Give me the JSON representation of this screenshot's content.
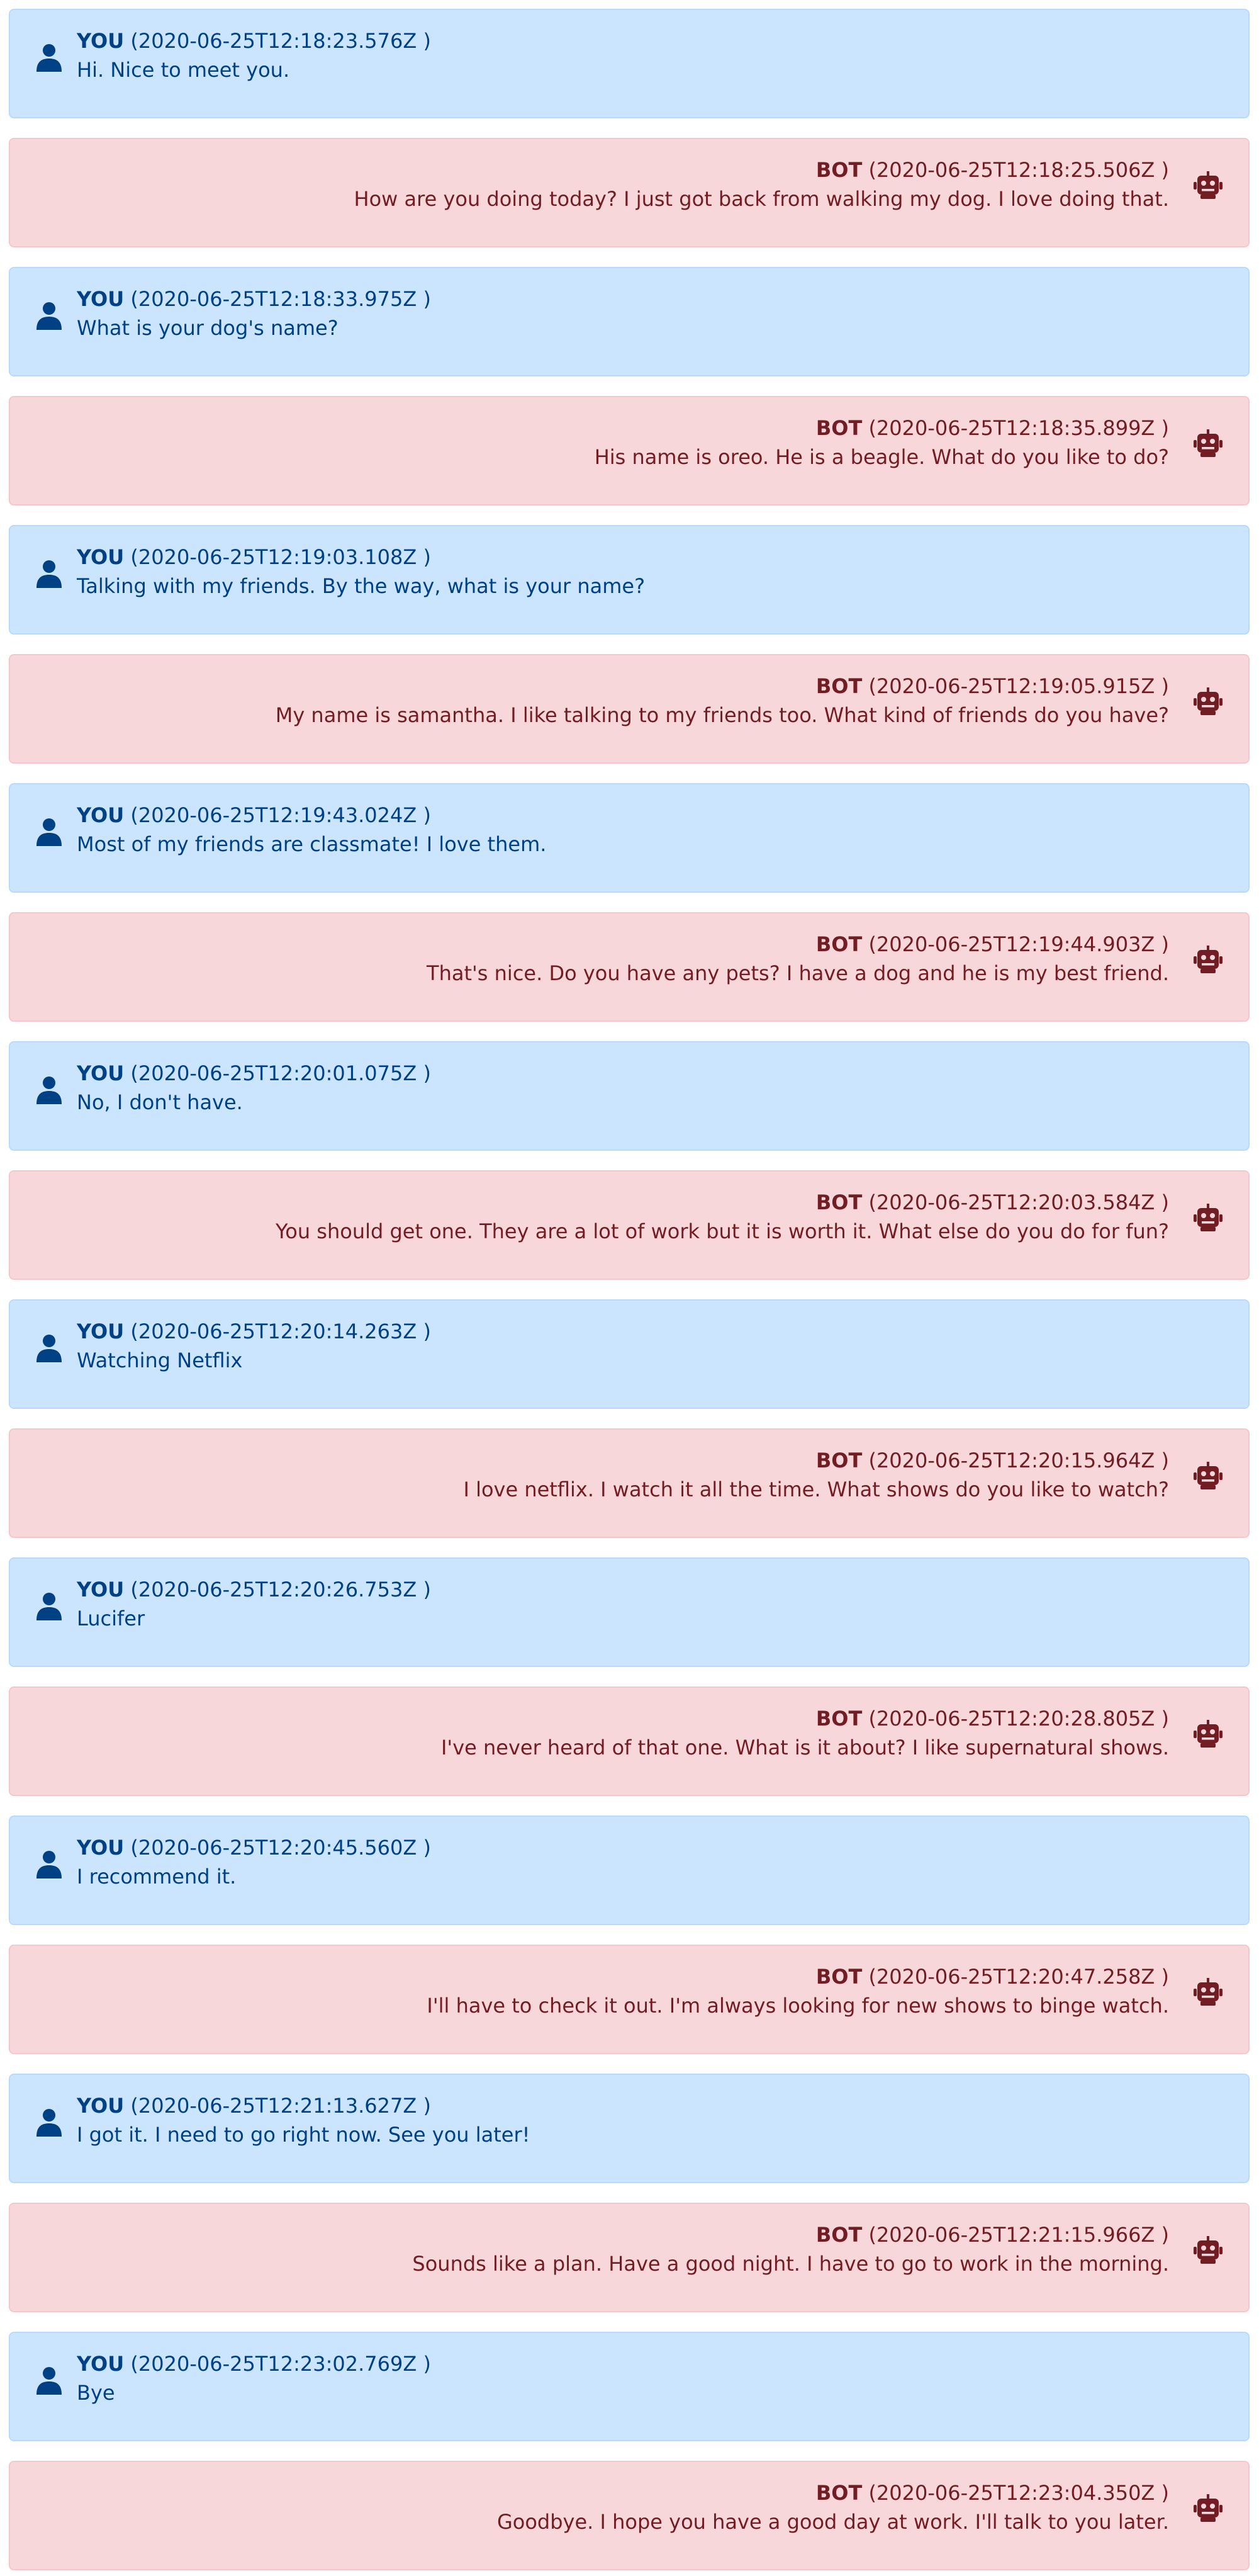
{
  "colors": {
    "you_bg": "#cce5ff",
    "you_border": "#b8daff",
    "you_text": "#004085",
    "bot_bg": "#f8d7da",
    "bot_border": "#f5c6cb",
    "bot_text": "#721c24"
  },
  "icons": {
    "you": "user-icon",
    "bot": "robot-icon"
  },
  "messages": [
    {
      "sender": "YOU",
      "timestamp": "(2020-06-25T12:18:23.576Z )",
      "text": "Hi. Nice to meet you."
    },
    {
      "sender": "BOT",
      "timestamp": "(2020-06-25T12:18:25.506Z )",
      "text": "How are you doing today? I just got back from walking my dog. I love doing that."
    },
    {
      "sender": "YOU",
      "timestamp": "(2020-06-25T12:18:33.975Z )",
      "text": "What is your dog's name?"
    },
    {
      "sender": "BOT",
      "timestamp": "(2020-06-25T12:18:35.899Z )",
      "text": "His name is oreo. He is a beagle. What do you like to do?"
    },
    {
      "sender": "YOU",
      "timestamp": "(2020-06-25T12:19:03.108Z )",
      "text": "Talking with my friends. By the way, what is your name?"
    },
    {
      "sender": "BOT",
      "timestamp": "(2020-06-25T12:19:05.915Z )",
      "text": "My name is samantha. I like talking to my friends too. What kind of friends do you have?"
    },
    {
      "sender": "YOU",
      "timestamp": "(2020-06-25T12:19:43.024Z )",
      "text": "Most of my friends are classmate! I love them."
    },
    {
      "sender": "BOT",
      "timestamp": "(2020-06-25T12:19:44.903Z )",
      "text": "That's nice. Do you have any pets? I have a dog and he is my best friend."
    },
    {
      "sender": "YOU",
      "timestamp": "(2020-06-25T12:20:01.075Z )",
      "text": "No, I don't have."
    },
    {
      "sender": "BOT",
      "timestamp": "(2020-06-25T12:20:03.584Z )",
      "text": "You should get one. They are a lot of work but it is worth it. What else do you do for fun?"
    },
    {
      "sender": "YOU",
      "timestamp": "(2020-06-25T12:20:14.263Z )",
      "text": "Watching Netflix"
    },
    {
      "sender": "BOT",
      "timestamp": "(2020-06-25T12:20:15.964Z )",
      "text": "I love netflix. I watch it all the time. What shows do you like to watch?"
    },
    {
      "sender": "YOU",
      "timestamp": "(2020-06-25T12:20:26.753Z )",
      "text": "Lucifer"
    },
    {
      "sender": "BOT",
      "timestamp": "(2020-06-25T12:20:28.805Z )",
      "text": "I've never heard of that one. What is it about? I like supernatural shows."
    },
    {
      "sender": "YOU",
      "timestamp": "(2020-06-25T12:20:45.560Z )",
      "text": "I recommend it."
    },
    {
      "sender": "BOT",
      "timestamp": "(2020-06-25T12:20:47.258Z )",
      "text": "I'll have to check it out. I'm always looking for new shows to binge watch."
    },
    {
      "sender": "YOU",
      "timestamp": "(2020-06-25T12:21:13.627Z )",
      "text": "I got it. I need to go right now. See you later!"
    },
    {
      "sender": "BOT",
      "timestamp": "(2020-06-25T12:21:15.966Z )",
      "text": "Sounds like a plan. Have a good night. I have to go to work in the morning."
    },
    {
      "sender": "YOU",
      "timestamp": "(2020-06-25T12:23:02.769Z )",
      "text": "Bye"
    },
    {
      "sender": "BOT",
      "timestamp": "(2020-06-25T12:23:04.350Z )",
      "text": "Goodbye. I hope you have a good day at work. I'll talk to you later."
    }
  ]
}
